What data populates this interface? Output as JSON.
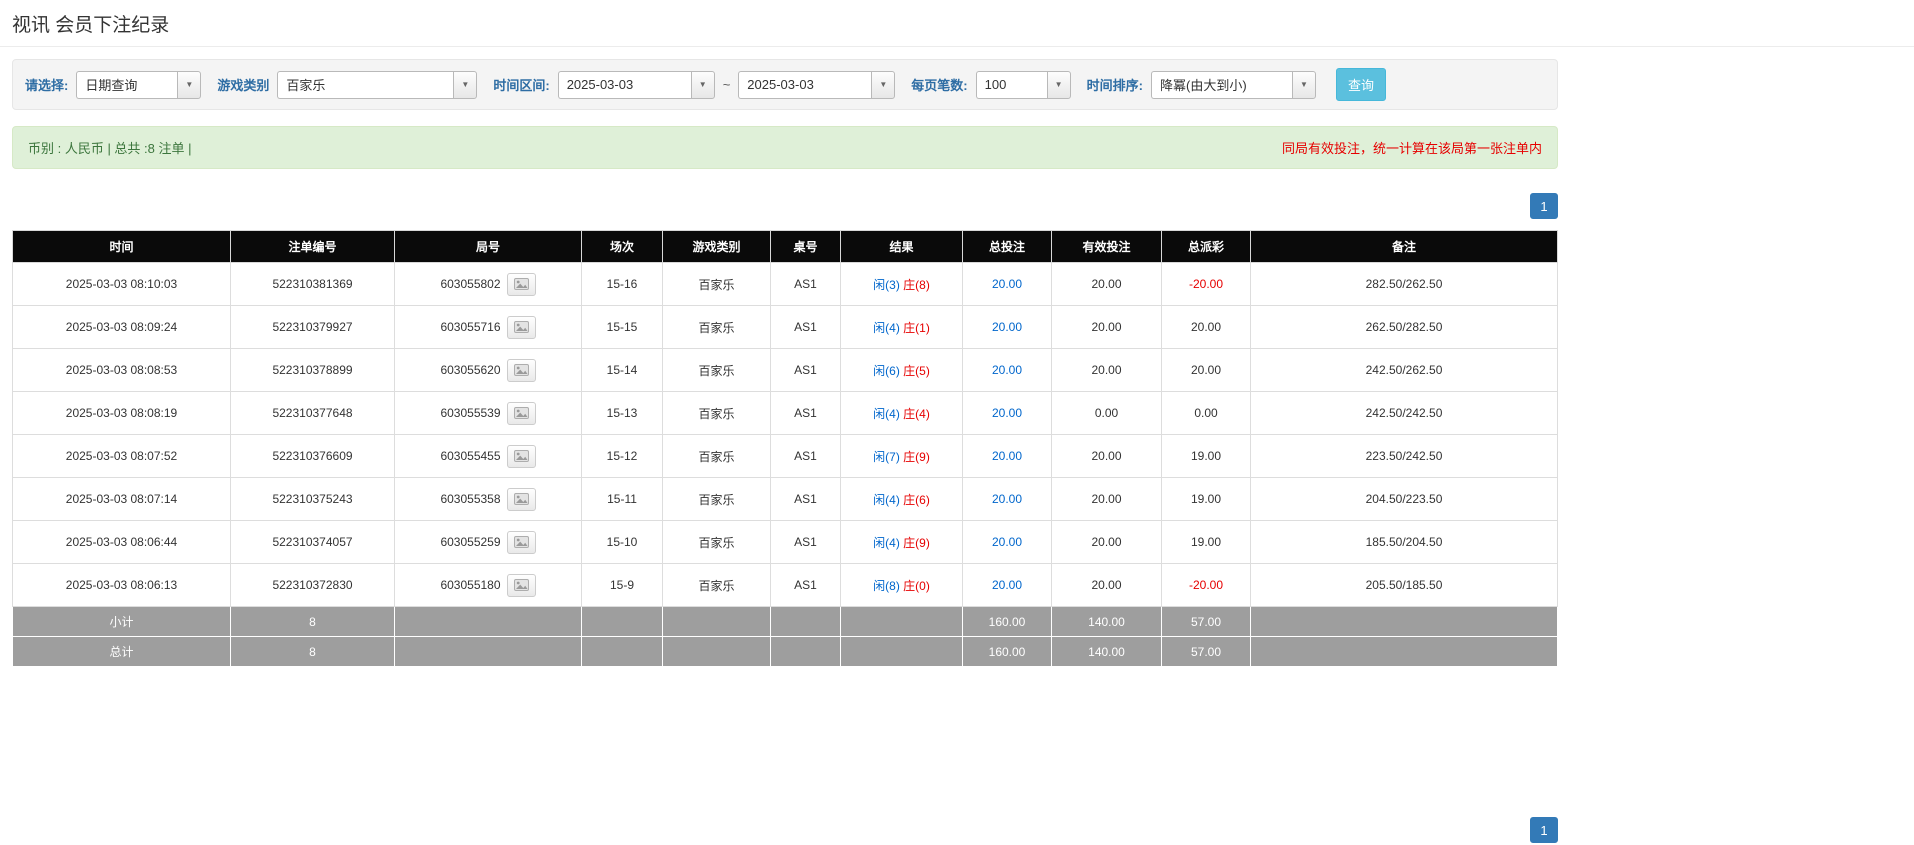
{
  "page": {
    "title": "视讯 会员下注纪录"
  },
  "icons": {
    "dropdown_arrow": "▼"
  },
  "filters": {
    "select_label": "请选择:",
    "select_value": "日期查询",
    "game_type_label": "游戏类别",
    "game_type_value": "百家乐",
    "date_range_label": "时间区间:",
    "date_from": "2025-03-03",
    "tilde": "~",
    "date_to": "2025-03-03",
    "page_size_label": "每页笔数:",
    "page_size_value": "100",
    "sort_label": "时间排序:",
    "sort_value": "降冪(由大到小)",
    "search_button": "查询"
  },
  "summary": {
    "left": "币别 : 人民币 | 总共 :8 注单 |",
    "right": "同局有效投注，统一计算在该局第一张注单内"
  },
  "pagination": {
    "page": "1"
  },
  "table": {
    "headers": [
      "时间",
      "注单编号",
      "局号",
      "场次",
      "游戏类别",
      "桌号",
      "结果",
      "总投注",
      "有效投注",
      "总派彩",
      "备注"
    ],
    "rows": [
      {
        "time": "2025-03-03 08:10:03",
        "bet_id": "522310381369",
        "round_id": "603055802",
        "session": "15-16",
        "game": "百家乐",
        "table_no": "AS1",
        "result_player": "闲(3)",
        "result_banker": "庄(8)",
        "total_bet": "20.00",
        "valid_bet": "20.00",
        "payout": "-20.00",
        "remark": "282.50/262.50"
      },
      {
        "time": "2025-03-03 08:09:24",
        "bet_id": "522310379927",
        "round_id": "603055716",
        "session": "15-15",
        "game": "百家乐",
        "table_no": "AS1",
        "result_player": "闲(4)",
        "result_banker": "庄(1)",
        "total_bet": "20.00",
        "valid_bet": "20.00",
        "payout": "20.00",
        "remark": "262.50/282.50"
      },
      {
        "time": "2025-03-03 08:08:53",
        "bet_id": "522310378899",
        "round_id": "603055620",
        "session": "15-14",
        "game": "百家乐",
        "table_no": "AS1",
        "result_player": "闲(6)",
        "result_banker": "庄(5)",
        "total_bet": "20.00",
        "valid_bet": "20.00",
        "payout": "20.00",
        "remark": "242.50/262.50"
      },
      {
        "time": "2025-03-03 08:08:19",
        "bet_id": "522310377648",
        "round_id": "603055539",
        "session": "15-13",
        "game": "百家乐",
        "table_no": "AS1",
        "result_player": "闲(4)",
        "result_banker": "庄(4)",
        "total_bet": "20.00",
        "valid_bet": "0.00",
        "payout": "0.00",
        "remark": "242.50/242.50"
      },
      {
        "time": "2025-03-03 08:07:52",
        "bet_id": "522310376609",
        "round_id": "603055455",
        "session": "15-12",
        "game": "百家乐",
        "table_no": "AS1",
        "result_player": "闲(7)",
        "result_banker": "庄(9)",
        "total_bet": "20.00",
        "valid_bet": "20.00",
        "payout": "19.00",
        "remark": "223.50/242.50"
      },
      {
        "time": "2025-03-03 08:07:14",
        "bet_id": "522310375243",
        "round_id": "603055358",
        "session": "15-11",
        "game": "百家乐",
        "table_no": "AS1",
        "result_player": "闲(4)",
        "result_banker": "庄(6)",
        "total_bet": "20.00",
        "valid_bet": "20.00",
        "payout": "19.00",
        "remark": "204.50/223.50"
      },
      {
        "time": "2025-03-03 08:06:44",
        "bet_id": "522310374057",
        "round_id": "603055259",
        "session": "15-10",
        "game": "百家乐",
        "table_no": "AS1",
        "result_player": "闲(4)",
        "result_banker": "庄(9)",
        "total_bet": "20.00",
        "valid_bet": "20.00",
        "payout": "19.00",
        "remark": "185.50/204.50"
      },
      {
        "time": "2025-03-03 08:06:13",
        "bet_id": "522310372830",
        "round_id": "603055180",
        "session": "15-9",
        "game": "百家乐",
        "table_no": "AS1",
        "result_player": "闲(8)",
        "result_banker": "庄(0)",
        "total_bet": "20.00",
        "valid_bet": "20.00",
        "payout": "-20.00",
        "remark": "205.50/185.50"
      }
    ],
    "subtotal": {
      "label": "小计",
      "count": "8",
      "total_bet": "160.00",
      "valid_bet": "140.00",
      "payout": "57.00"
    },
    "total": {
      "label": "总计",
      "count": "8",
      "total_bet": "160.00",
      "valid_bet": "140.00",
      "payout": "57.00"
    }
  }
}
